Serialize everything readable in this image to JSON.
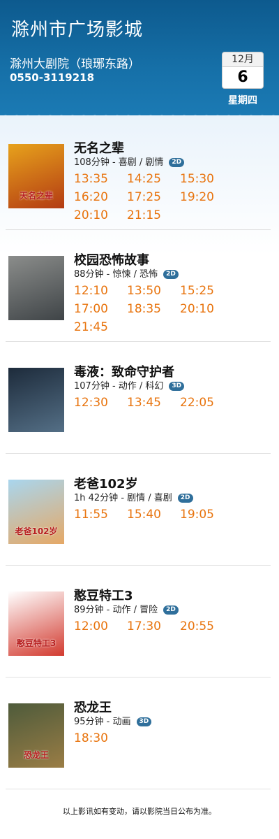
{
  "header": {
    "cinema_name": "滁州市广场影城",
    "address": "滁州大剧院（琅琊东路）",
    "phone": "0550-3119218",
    "date": {
      "month": "12月",
      "day": "6",
      "weekday": "星期四"
    }
  },
  "movies": [
    {
      "title": "无名之辈",
      "meta": "108分钟 - 喜剧 / 剧情",
      "format": "2D",
      "times": [
        "13:35",
        "14:25",
        "15:30",
        "16:20",
        "17:25",
        "19:20",
        "20:10",
        "21:15"
      ]
    },
    {
      "title": "校园恐怖故事",
      "meta": "88分钟 - 惊悚 / 恐怖",
      "format": "2D",
      "times": [
        "12:10",
        "13:50",
        "15:25",
        "17:00",
        "18:35",
        "20:10",
        "21:45"
      ]
    },
    {
      "title": "毒液：致命守护者",
      "meta": "107分钟 - 动作 / 科幻",
      "format": "3D",
      "times": [
        "12:30",
        "13:45",
        "22:05"
      ]
    },
    {
      "title": "老爸102岁",
      "meta": "1h 42分钟 - 剧情 / 喜剧",
      "format": "2D",
      "times": [
        "11:55",
        "15:40",
        "19:05"
      ]
    },
    {
      "title": "憨豆特工3",
      "meta": "89分钟 - 动作 / 冒险",
      "format": "2D",
      "times": [
        "12:00",
        "17:30",
        "20:55"
      ]
    },
    {
      "title": "恐龙王",
      "meta": "95分钟 - 动画",
      "format": "3D",
      "times": [
        "18:30"
      ]
    }
  ],
  "posters": [
    {
      "name": "poster-wuming",
      "colors": [
        "#e7a21c",
        "#b33b13"
      ],
      "text": "天名之辈"
    },
    {
      "name": "poster-xiaoyuan",
      "colors": [
        "#8b8d8b",
        "#3f4447"
      ],
      "text": ""
    },
    {
      "name": "poster-venom",
      "colors": [
        "#1d2b3b",
        "#546f86"
      ],
      "text": ""
    },
    {
      "name": "poster-laoba",
      "colors": [
        "#a9d6ee",
        "#e5a866"
      ],
      "text": "老爸102岁"
    },
    {
      "name": "poster-handou",
      "colors": [
        "#ffffff",
        "#d23a2f"
      ],
      "text": "憨豆特工3"
    },
    {
      "name": "poster-konglong",
      "colors": [
        "#4e5b3b",
        "#9a7d45"
      ],
      "text": "恐龙王"
    }
  ],
  "footer": {
    "notice": "以上影讯如有变动，请以影院当日公布为准。"
  }
}
